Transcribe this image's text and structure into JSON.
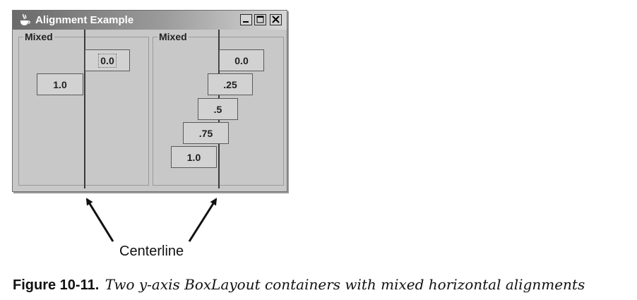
{
  "window": {
    "title": "Alignment Example",
    "buttons": {
      "minimize_icon": "minimize-icon",
      "maximize_icon": "maximize-icon",
      "close_icon": "close-icon"
    }
  },
  "panels": [
    {
      "title": "Mixed",
      "buttons": [
        {
          "label": "0.0"
        },
        {
          "label": "1.0"
        }
      ]
    },
    {
      "title": "Mixed",
      "buttons": [
        {
          "label": "0.0"
        },
        {
          "label": ".25"
        },
        {
          "label": ".5"
        },
        {
          "label": ".75"
        },
        {
          "label": "1.0"
        }
      ]
    }
  ],
  "annotation": {
    "label": "Centerline"
  },
  "caption": {
    "label": "Figure 10-11.",
    "text": "Two y-axis BoxLayout containers with mixed horizontal alignments"
  },
  "colors": {
    "window_bg": "#c8c8c8",
    "titlebar_dark": "#6a6a6a",
    "titlebar_light": "#d7d7d7"
  }
}
